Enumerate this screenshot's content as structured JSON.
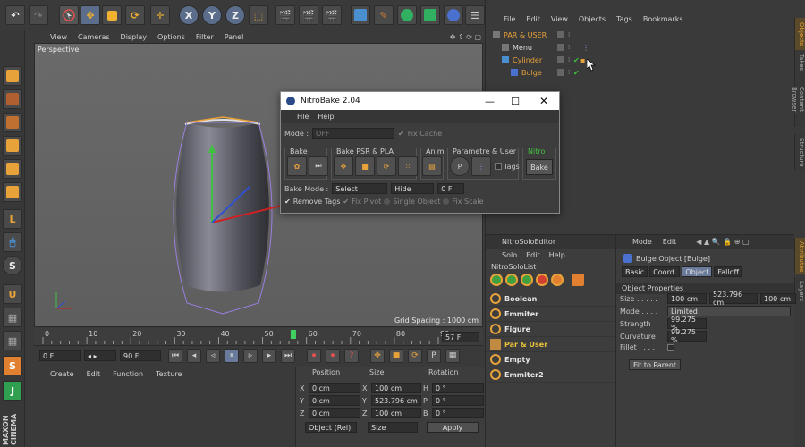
{
  "top_menu": [
    "File",
    "Edit",
    "View",
    "Objects",
    "Tags",
    "Bookmarks"
  ],
  "viewport": {
    "menu": [
      "View",
      "Cameras",
      "Display",
      "Options",
      "Filter",
      "Panel"
    ],
    "label": "Perspective",
    "grid_spacing": "Grid Spacing : 1000 cm"
  },
  "objects": [
    {
      "name": "PAR & USER",
      "color": "#e8a23a"
    },
    {
      "name": "Menu",
      "color": "#dcdcdc"
    },
    {
      "name": "Cylinder",
      "color": "#e8a23a"
    },
    {
      "name": "Bulge",
      "color": "#e8a23a"
    }
  ],
  "dialog": {
    "title": "NitroBake 2.04",
    "menu": [
      "File",
      "Help"
    ],
    "mode_label": "Mode :",
    "mode_value": "OFF",
    "fix_cache": "Fix Cache",
    "groups": {
      "bake": "Bake",
      "bake_psr": "Bake PSR & PLA",
      "anim": "Anim",
      "param": "Parametre & User",
      "nitro": "Nitro"
    },
    "tags_label": "Tags",
    "bake_button": "Bake",
    "bake_mode_label": "Bake Mode :",
    "bake_mode_value": "Select",
    "hide_value": "Hide",
    "frame_value": "0 F",
    "remove_tags": "Remove Tags",
    "fix_pivot": "Fix Pivot",
    "single_object": "Single Object",
    "fix_scale": "Fix Scale"
  },
  "timeline": {
    "ticks": [
      "0",
      "10",
      "20",
      "30",
      "40",
      "50",
      "60",
      "70",
      "80",
      "90"
    ],
    "end_frame": "57 F",
    "start_field": "0 F",
    "end_field": "90 F"
  },
  "materials_menu": [
    "Create",
    "Edit",
    "Function",
    "Texture"
  ],
  "coords": {
    "headers": [
      "Position",
      "Size",
      "Rotation"
    ],
    "rows": [
      {
        "axis": "X",
        "pos": "0 cm",
        "size": "100 cm",
        "rot_axis": "H",
        "rot": "0 °"
      },
      {
        "axis": "Y",
        "pos": "0 cm",
        "size": "523.796 cm",
        "rot_axis": "P",
        "rot": "0 °"
      },
      {
        "axis": "Z",
        "pos": "0 cm",
        "size": "100 cm",
        "rot_axis": "B",
        "rot": "0 °"
      }
    ],
    "mode": "Object (Rel)",
    "size_mode": "Size",
    "apply": "Apply"
  },
  "solo": {
    "title": "NitroSoloEditor",
    "menu": [
      "Solo",
      "Edit",
      "Help"
    ],
    "list_label": "NitroSoloList",
    "items": [
      {
        "name": "Boolean",
        "color": "#e6e6e6"
      },
      {
        "name": "Emmiter",
        "color": "#e6e6e6"
      },
      {
        "name": "Figure",
        "color": "#e6e6e6"
      },
      {
        "name": "Par & User",
        "color": "#e8c23a"
      },
      {
        "name": "Empty",
        "color": "#e6e6e6"
      },
      {
        "name": "Emmiter2",
        "color": "#e6e6e6"
      }
    ]
  },
  "attributes": {
    "menu": [
      "Mode",
      "Edit"
    ],
    "object_title": "Bulge Object [Bulge]",
    "tabs": [
      "Basic",
      "Coord.",
      "Object",
      "Falloff"
    ],
    "section": "Object Properties",
    "size_label": "Size . . . . .",
    "size_values": [
      "100 cm",
      "523.796 cm",
      "100 cm"
    ],
    "mode_label": "Mode . . . .",
    "mode_value": "Limited",
    "strength_label": "Strength",
    "strength_value": "99.275 %",
    "curvature_label": "Curvature",
    "curvature_value": "99.275 %",
    "fillet_label": "Fillet . . . .",
    "fit_button": "Fit to Parent"
  },
  "side_tabs": [
    "Objects",
    "Takes",
    "Content Browser",
    "Structure"
  ],
  "side_tabs2": [
    "Attributes",
    "Layers"
  ]
}
